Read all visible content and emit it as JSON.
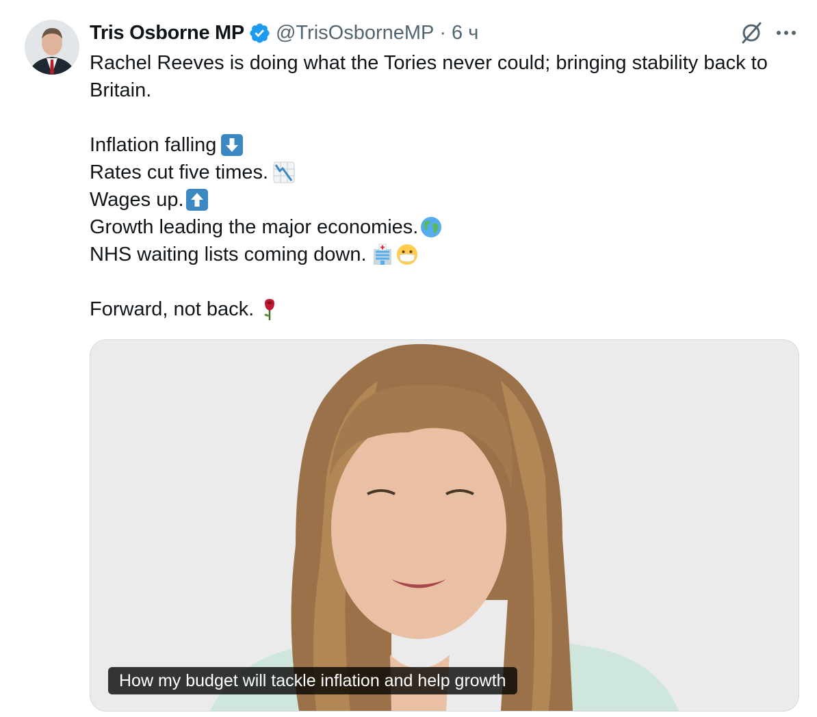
{
  "author": {
    "name": "Tris Osborne MP",
    "handle": "@TrisOsborneMP",
    "separator": "·",
    "time": "6 ч",
    "verified": true
  },
  "icons": {
    "verified": "verified-badge-icon",
    "grok": "grok-icon",
    "more": "more-options-icon"
  },
  "text": {
    "intro": "Rachel Reeves is doing what the Tories never could; bringing stability back to Britain.",
    "lines": [
      "Inflation falling",
      "Rates cut five times.",
      "Wages up.",
      "Growth leading the major economies.",
      "NHS waiting lists coming down."
    ],
    "closing": "Forward, not back."
  },
  "emojis": [
    "down-arrow-emoji",
    "chart-decreasing-emoji",
    "up-arrow-emoji",
    "globe-emoji",
    "hospital-emoji",
    "mask-face-emoji",
    "rose-emoji"
  ],
  "media": {
    "caption": "How my budget will tackle inflation and help growth"
  },
  "colors": {
    "text": "#0f1419",
    "secondary": "#536471",
    "verified": "#1d9bf0",
    "border": "#cfd9de"
  }
}
